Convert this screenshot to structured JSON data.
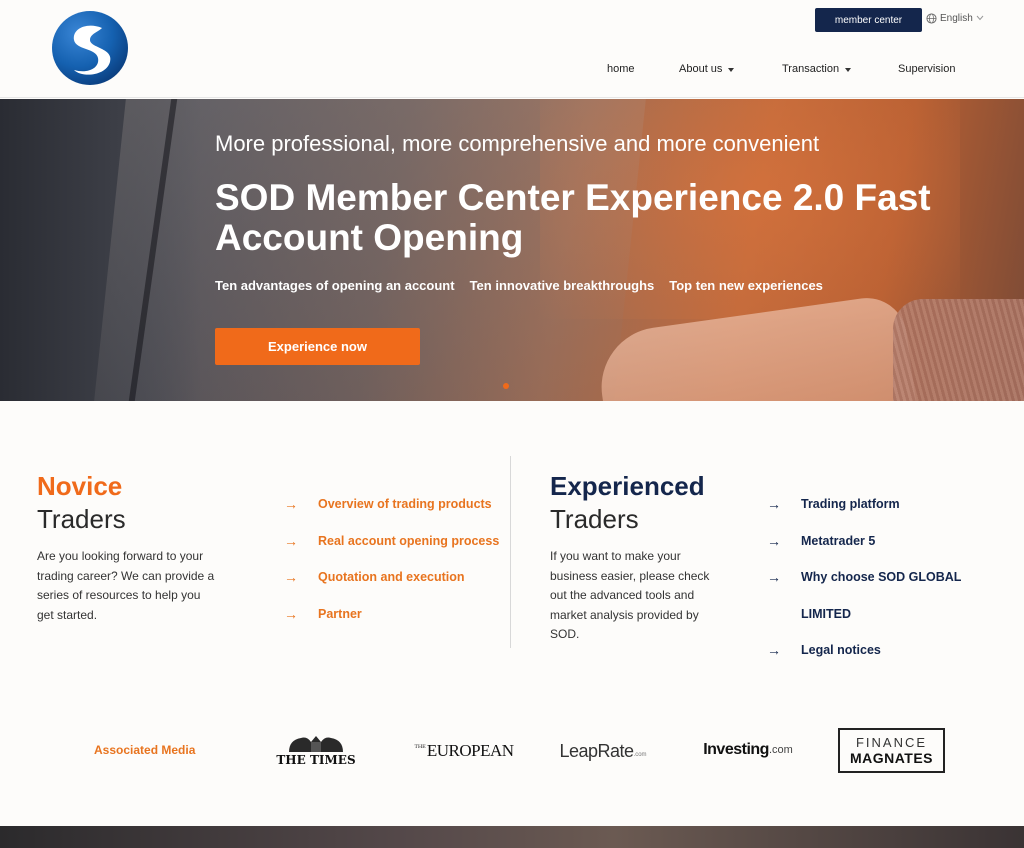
{
  "colors": {
    "navy": "#14264c",
    "orange": "#f06a1a",
    "orange_text": "#e8741f",
    "logo_blue": "#1561b0"
  },
  "header": {
    "logo_icon": "sod-logo",
    "member_center_label": "member center",
    "language": "English",
    "language_icon": "globe-icon",
    "nav": [
      {
        "label": "home",
        "has_dropdown": false
      },
      {
        "label": "About us",
        "has_dropdown": true
      },
      {
        "label": "Transaction",
        "has_dropdown": true
      },
      {
        "label": "Supervision",
        "has_dropdown": false
      }
    ]
  },
  "hero": {
    "subtitle": "More professional, more comprehensive and more convenient",
    "title": "SOD Member Center Experience 2.0 Fast Account Opening",
    "points": [
      "Ten advantages of opening an account",
      "Ten innovative breakthroughs",
      "Top ten new experiences"
    ],
    "cta_label": "Experience now"
  },
  "novice": {
    "title_strong": "Novice",
    "title_light": "Traders",
    "description": "Are you looking forward to your trading career? We can provide a series of resources to help you get started.",
    "links": [
      "Overview of trading products",
      "Real account opening process",
      "Quotation and execution",
      "Partner"
    ]
  },
  "experienced": {
    "title_strong": "Experienced",
    "title_light": "Traders",
    "description": "If you want to make your business easier, please check out the advanced tools and market analysis provided by SOD.",
    "links": [
      "Trading platform",
      "Metatrader 5",
      "Why choose SOD GLOBAL LIMITED",
      "Legal notices"
    ]
  },
  "media": {
    "label": "Associated Media",
    "logos": [
      {
        "name": "THE TIMES"
      },
      {
        "name": "EUROPEAN",
        "prefix": "THE"
      },
      {
        "name": "LeapRate",
        "suffix": ".com"
      },
      {
        "name": "Investing",
        "suffix": ".com"
      },
      {
        "name": "FINANCE",
        "line2": "MAGNATES"
      }
    ]
  }
}
